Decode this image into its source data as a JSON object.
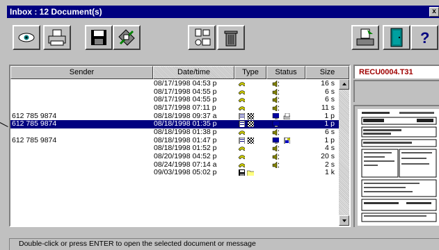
{
  "window": {
    "title": "Inbox : 12 Document(s)",
    "close_glyph": "x"
  },
  "toolbar": {
    "buttons": [
      {
        "icon": "view-eye-icon"
      },
      {
        "icon": "print-icon"
      },
      {
        "icon": "save-disk-icon"
      },
      {
        "icon": "tools-icon"
      },
      {
        "icon": "fax-phone-icon"
      },
      {
        "icon": "trash-bin-icon"
      },
      {
        "icon": "send-tray-icon"
      },
      {
        "icon": "exit-door-icon"
      },
      {
        "icon": "help-icon"
      }
    ]
  },
  "grid": {
    "columns": [
      "Sender",
      "Date/time",
      "Type",
      "Status",
      "Size"
    ],
    "rows": [
      {
        "sender": "",
        "datetime": "08/17/1998 04:53 p",
        "type": [
          "phone"
        ],
        "status": [
          "speaker"
        ],
        "size": "16 s"
      },
      {
        "sender": "",
        "datetime": "08/17/1998 04:55 p",
        "type": [
          "phone"
        ],
        "status": [
          "speaker"
        ],
        "size": "6 s"
      },
      {
        "sender": "",
        "datetime": "08/17/1998 04:55 p",
        "type": [
          "phone"
        ],
        "status": [
          "speaker"
        ],
        "size": "6 s"
      },
      {
        "sender": "",
        "datetime": "08/17/1998 07:11 p",
        "type": [
          "phone"
        ],
        "status": [
          "speaker"
        ],
        "size": "11 s"
      },
      {
        "sender": "612 785 9874",
        "datetime": "08/18/1998 09:37 a",
        "type": [
          "doc",
          "checker"
        ],
        "status": [
          "monitor",
          "fax"
        ],
        "size": "1 p"
      },
      {
        "sender": "612 785 9874",
        "datetime": "08/18/1998 01:35 p",
        "type": [
          "doc",
          "checker"
        ],
        "status": [
          "monitor"
        ],
        "size": "1 p",
        "selected": true
      },
      {
        "sender": "",
        "datetime": "08/18/1998 01:38 p",
        "type": [
          "phone"
        ],
        "status": [
          "speaker"
        ],
        "size": "6 s"
      },
      {
        "sender": "612 785 9874",
        "datetime": "08/18/1998 01:47 p",
        "type": [
          "doc",
          "checker"
        ],
        "status": [
          "monitor",
          "note"
        ],
        "size": "1 p"
      },
      {
        "sender": "",
        "datetime": "08/18/1998 01:52 p",
        "type": [
          "phone"
        ],
        "status": [
          "speaker"
        ],
        "size": "4 s"
      },
      {
        "sender": "",
        "datetime": "08/20/1998 04:52 p",
        "type": [
          "phone"
        ],
        "status": [
          "speaker"
        ],
        "size": "20 s"
      },
      {
        "sender": "",
        "datetime": "08/24/1998 07:14 a",
        "type": [
          "phone"
        ],
        "status": [
          "speaker"
        ],
        "size": "2 s"
      },
      {
        "sender": "",
        "datetime": "09/03/1998 05:02 p",
        "type": [
          "disk",
          "folder"
        ],
        "status": [],
        "size": "1 k"
      }
    ]
  },
  "preview": {
    "filename": "RECU0004.T31"
  },
  "status_bar": {
    "text": "Double-click or press ENTER to open the selected document or message"
  },
  "colors": {
    "title_bg": "#000080",
    "selection": "#000080",
    "filename": "#a00000"
  }
}
